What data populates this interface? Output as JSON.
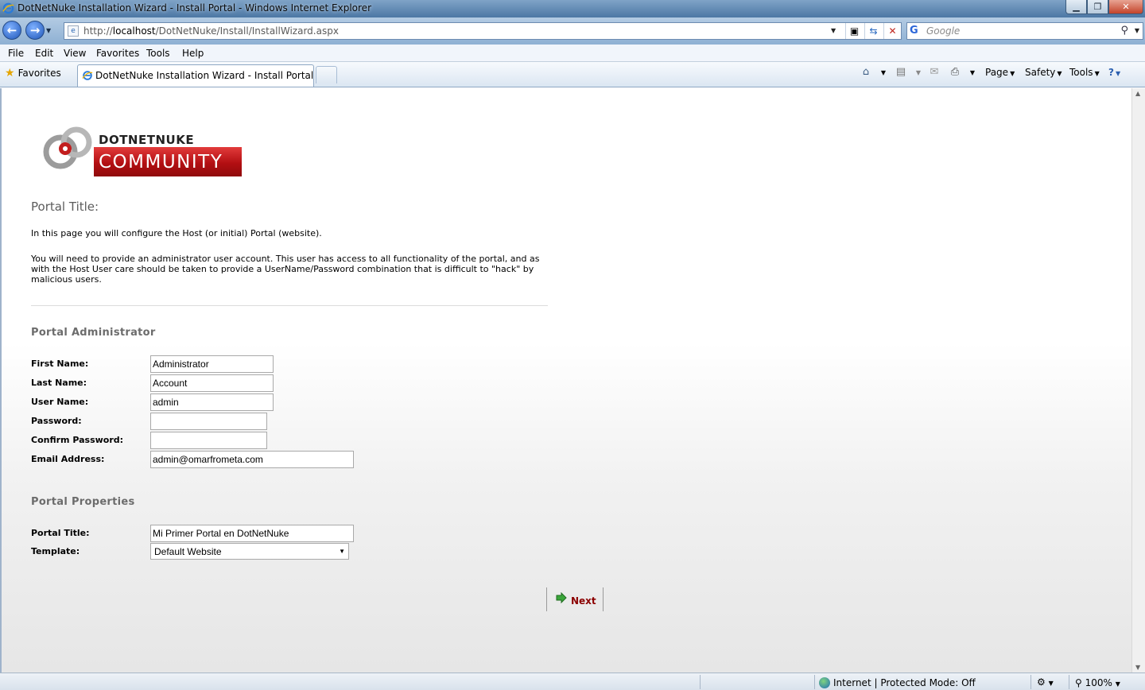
{
  "window": {
    "title": "DotNetNuke Installation Wizard - Install Portal - Windows Internet Explorer"
  },
  "address": {
    "url_prefix": "http://",
    "url_host": "localhost",
    "url_path": "/DotNetNuke/Install/InstallWizard.aspx",
    "search_placeholder": "Google"
  },
  "menu": [
    "File",
    "Edit",
    "View",
    "Favorites",
    "Tools",
    "Help"
  ],
  "tabs": {
    "favorites_label": "Favorites",
    "active_tab": "DotNetNuke Installation Wizard - Install Portal"
  },
  "command_bar": {
    "page": "Page",
    "safety": "Safety",
    "tools": "Tools"
  },
  "logo": {
    "top_text": "DOTNETNUKE",
    "bottom_text": "COMMUNITY"
  },
  "page": {
    "heading": "Portal Title:",
    "intro": "In this page you will configure the Host (or initial) Portal (website).",
    "description": "You will need to provide an administrator user account. This user has access to all functionality of the portal, and as with the Host User care should be taken to provide a UserName/Password combination that is difficult to \"hack\" by malicious users."
  },
  "admin_section": {
    "title": "Portal Administrator",
    "first_name_label": "First Name:",
    "first_name_value": "Administrator",
    "last_name_label": "Last Name:",
    "last_name_value": "Account",
    "user_name_label": "User Name:",
    "user_name_value": "admin",
    "password_label": "Password:",
    "password_value": "",
    "confirm_password_label": "Confirm Password:",
    "confirm_password_value": "",
    "email_label": "Email Address:",
    "email_value": "admin@omarfrometa.com"
  },
  "properties_section": {
    "title": "Portal Properties",
    "portal_title_label": "Portal Title:",
    "portal_title_value": "Mi Primer Portal en DotNetNuke",
    "template_label": "Template:",
    "template_value": "Default Website"
  },
  "actions": {
    "next_label": "Next"
  },
  "status": {
    "zone": "Internet | Protected Mode: Off",
    "zoom": "100%"
  }
}
